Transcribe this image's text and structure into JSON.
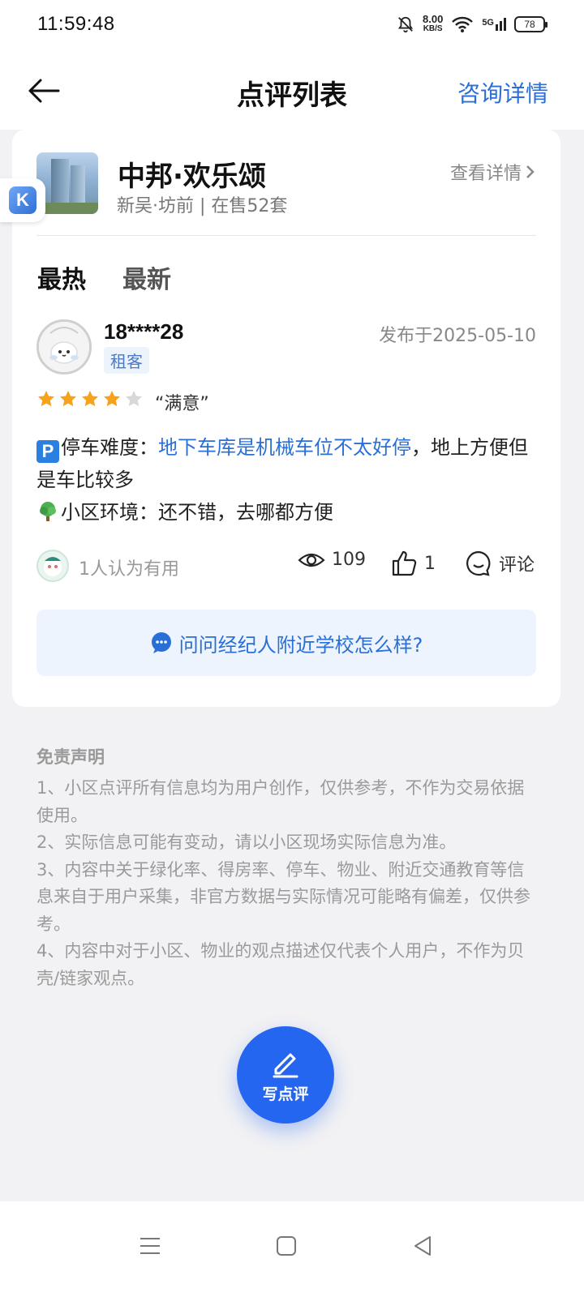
{
  "status_bar": {
    "time": "11:59:48",
    "net_speed": "8.00",
    "net_unit": "KB/S",
    "network": "5G",
    "battery": "78"
  },
  "nav": {
    "title": "点评列表",
    "action": "咨询详情"
  },
  "project": {
    "name": "中邦·欢乐颂",
    "subtitle": "新吴·坊前 | 在售52套",
    "detail_link": "查看详情"
  },
  "tabs": [
    "最热",
    "最新"
  ],
  "review": {
    "username": "18****28",
    "role": "租客",
    "date": "发布于2025-05-10",
    "rating": 4,
    "rating_max": 5,
    "rating_text": "“满意”",
    "parking_label": "停车难度：",
    "parking_highlight": "地下车库是机械车位不太好停",
    "parking_rest": "，地上方便但是车比较多",
    "env_label": "小区环境：",
    "env_text": "还不错，去哪都方便",
    "useful": "1人认为有用",
    "views": "109",
    "likes": "1",
    "comment_label": "评论"
  },
  "ask_agent": "问问经纪人附近学校怎么样?",
  "disclaimer": {
    "title": "免责声明",
    "lines": [
      "1、小区点评所有信息均为用户创作，仅供参考，不作为交易依据使用。",
      "2、实际信息可能有变动，请以小区现场实际信息为准。",
      "3、内容中关于绿化率、得房率、停车、物业、附近交通教育等信息来自于用户采集，非官方数据与实际情况可能略有偏差，仅供参考。",
      "4、内容中对于小区、物业的观点描述仅代表个人用户，不作为贝壳/链家观点。"
    ]
  },
  "fab_label": "写点评",
  "colors": {
    "accent": "#2a6fd8",
    "fab": "#2566f0",
    "star": "#f7a21b"
  }
}
